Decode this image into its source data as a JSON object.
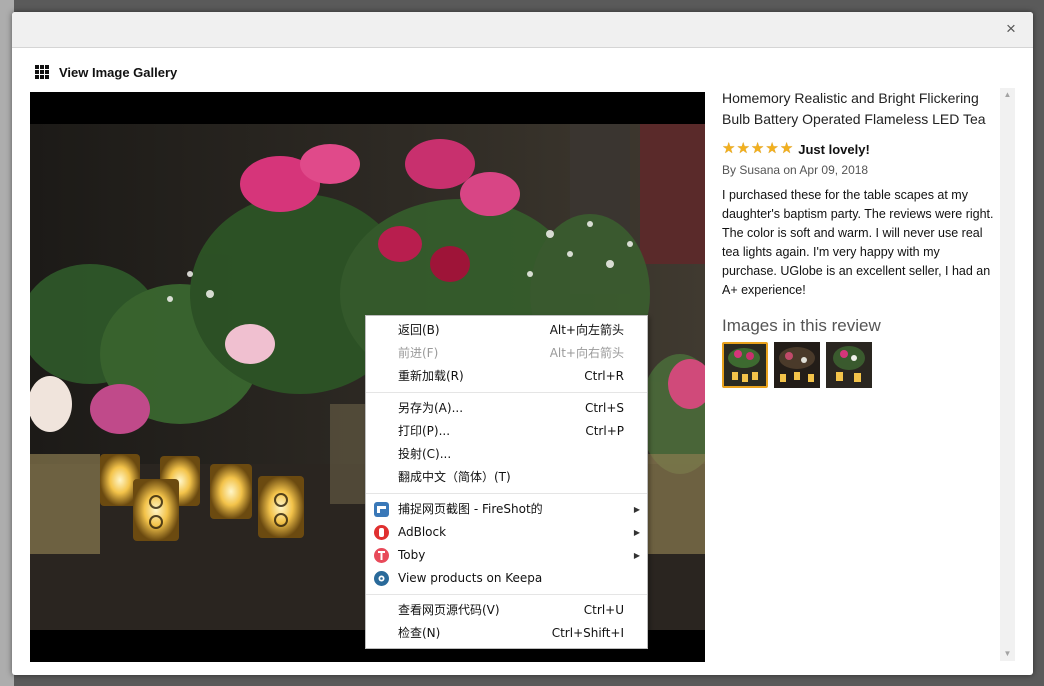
{
  "gallery": {
    "title": "View Image Gallery",
    "close_label": "×"
  },
  "review": {
    "product_title": "Homemory Realistic and Bright Flickering Bulb Battery Operated Flameless LED Tea",
    "rating": 5,
    "title": "Just lovely!",
    "byline": "By Susana on Apr 09, 2018",
    "body": "I purchased these for the table scapes at my daughter's baptism party. The reviews were right. The color is soft and warm. I will never use real tea lights again. I'm very happy with my purchase. UGlobe is an excellent seller, I had an A+ experience!",
    "images_heading": "Images in this review"
  },
  "context_menu": {
    "back": {
      "label": "返回(B)",
      "shortcut": "Alt+向左箭头"
    },
    "forward": {
      "label": "前进(F)",
      "shortcut": "Alt+向右箭头"
    },
    "reload": {
      "label": "重新加载(R)",
      "shortcut": "Ctrl+R"
    },
    "save_as": {
      "label": "另存为(A)...",
      "shortcut": "Ctrl+S"
    },
    "print": {
      "label": "打印(P)...",
      "shortcut": "Ctrl+P"
    },
    "cast": {
      "label": "投射(C)..."
    },
    "translate": {
      "label": "翻成中文（简体）(T)"
    },
    "fireshot": {
      "label": "捕捉网页截图 - FireShot的"
    },
    "adblock": {
      "label": "AdBlock"
    },
    "toby": {
      "label": "Toby"
    },
    "keepa": {
      "label": "View products on Keepa"
    },
    "view_source": {
      "label": "查看网页源代码(V)",
      "shortcut": "Ctrl+U"
    },
    "inspect": {
      "label": "检查(N)",
      "shortcut": "Ctrl+Shift+I"
    }
  },
  "colors": {
    "star": "#f2b01e",
    "thumb_selected_border": "#e9a21e",
    "backdrop": "#5a5a5a"
  },
  "icons": [
    "grid-icon",
    "close-icon",
    "star-icon",
    "fireshot-icon",
    "adblock-icon",
    "toby-icon",
    "keepa-icon",
    "chevron-right-icon",
    "scroll-up-icon",
    "scroll-down-icon"
  ]
}
